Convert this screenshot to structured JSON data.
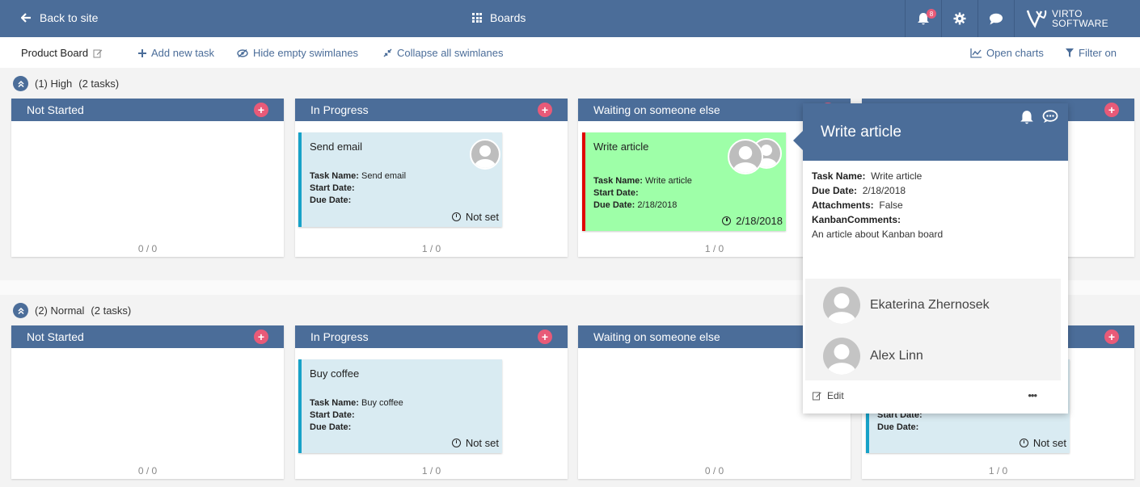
{
  "topbar": {
    "back_label": "Back to site",
    "boards_label": "Boards",
    "notification_count": "8",
    "logo_line1": "VIRTO",
    "logo_line2": "SOFTWARE"
  },
  "toolbar": {
    "board_name": "Product Board",
    "add_task": "Add new task",
    "hide_empty": "Hide empty swimlanes",
    "collapse_all": "Collapse all swimlanes",
    "open_charts": "Open charts",
    "filter_on": "Filter on"
  },
  "lanes": [
    {
      "title": "(1) High",
      "count": "(2 tasks)",
      "columns": [
        {
          "name": "Not Started",
          "count": "0 / 0"
        },
        {
          "name": "In Progress",
          "count": "1 / 0"
        },
        {
          "name": "Waiting on someone else",
          "count": "1 / 0"
        }
      ]
    },
    {
      "title": "(2) Normal",
      "count": "(2 tasks)",
      "columns": [
        {
          "name": "Not Started",
          "count": "0 / 0"
        },
        {
          "name": "In Progress",
          "count": "1 / 0"
        },
        {
          "name": "Waiting on someone else",
          "count": "0 / 0"
        },
        {
          "name": "",
          "count": "1 / 0"
        }
      ]
    }
  ],
  "cards": {
    "send_email": {
      "title": "Send email",
      "task_name_label": "Task Name:",
      "task_name": "Send email",
      "start_label": "Start Date:",
      "due_label": "Due Date:",
      "due": "",
      "date_display": "Not set"
    },
    "write_article": {
      "title": "Write article",
      "task_name_label": "Task Name:",
      "task_name": "Write article",
      "start_label": "Start Date:",
      "due_label": "Due Date:",
      "due": "2/18/2018",
      "date_display": "2/18/2018"
    },
    "buy_coffee": {
      "title": "Buy coffee",
      "task_name_label": "Task Name:",
      "task_name": "Buy coffee",
      "start_label": "Start Date:",
      "due_label": "Due Date:",
      "due": "",
      "date_display": "Not set"
    },
    "partial": {
      "start_label": "Start Date:",
      "due_label": "Due Date:",
      "date_display": "Not set"
    }
  },
  "popup": {
    "title": "Write article",
    "task_name_label": "Task Name:",
    "task_name": "Write article",
    "due_label": "Due Date:",
    "due": "2/18/2018",
    "attachments_label": "Attachments:",
    "attachments": "False",
    "comments_label": "KanbanComments:",
    "comments": "An article about Kanban board",
    "users": [
      "Ekaterina Zhernosek",
      "Alex Linn"
    ],
    "edit_label": "Edit",
    "more_label": "•••"
  },
  "colors": {
    "header_blue": "#4b6d99",
    "add_pink": "#e85a78",
    "card_blue": "#d9ebf2",
    "card_green": "#9effa8"
  }
}
